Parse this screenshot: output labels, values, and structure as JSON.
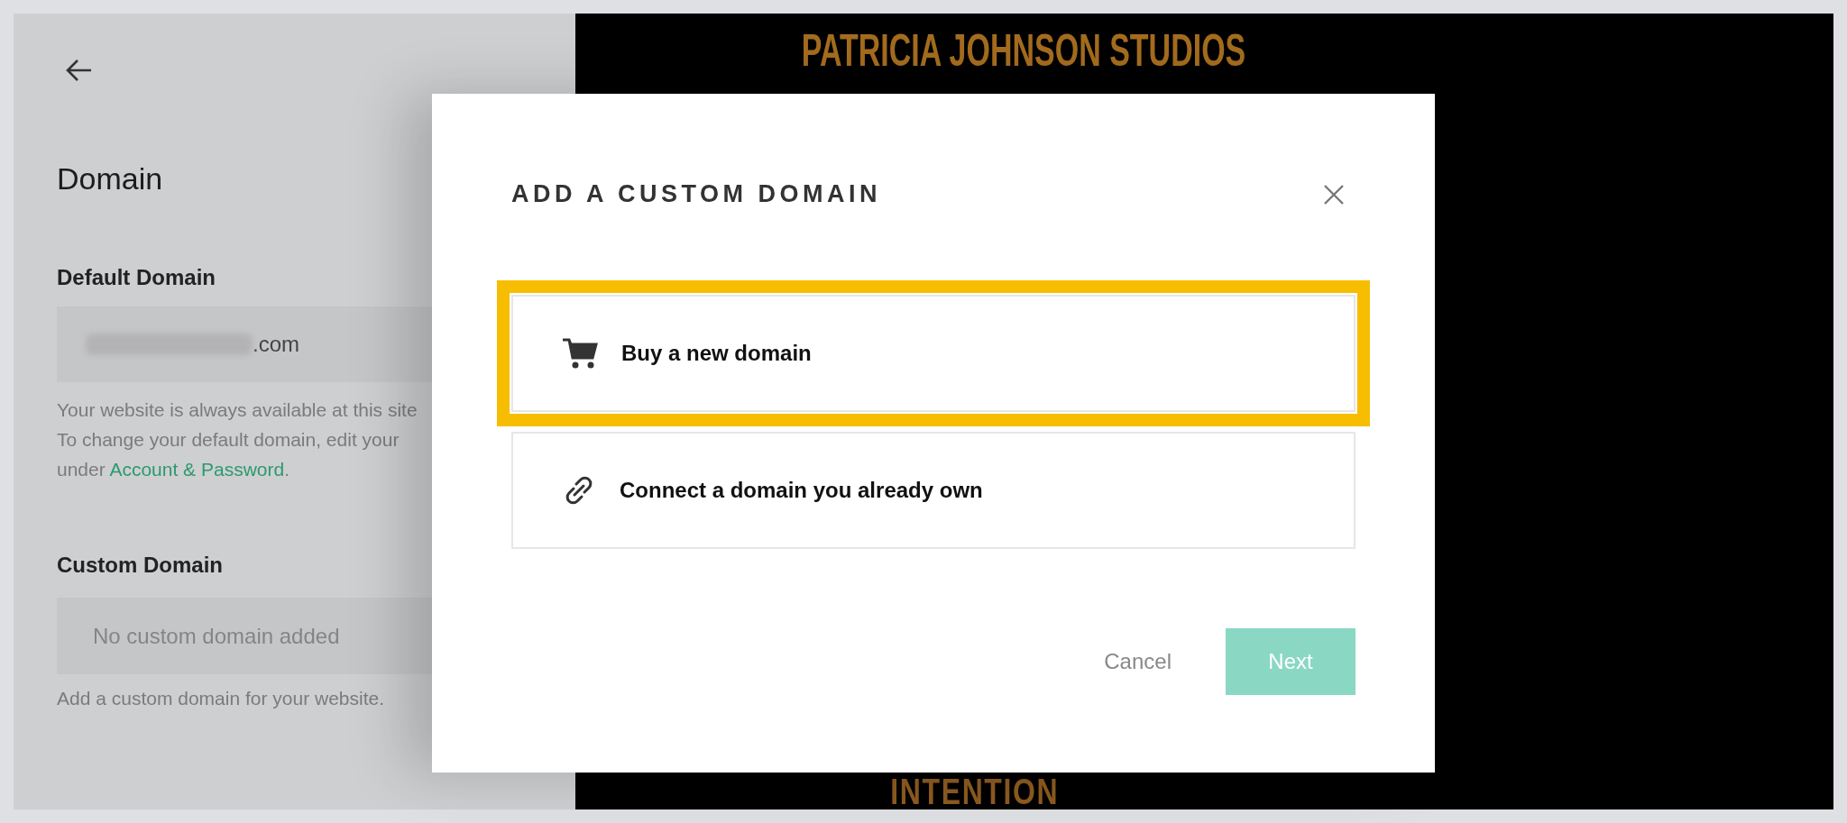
{
  "settings_panel": {
    "title": "Domain",
    "default_domain": {
      "label": "Default Domain",
      "value_suffix": ".com",
      "help_lines": [
        "Your website is always available at this site",
        "To change your default domain, edit your"
      ],
      "help_link_line": {
        "before": "under ",
        "link": "Account & Password",
        "after": "."
      }
    },
    "custom_domain": {
      "label": "Custom Domain",
      "placeholder": "No custom domain added",
      "help": "Add a custom domain for your website."
    }
  },
  "site_preview": {
    "header": "PATRICIA JOHNSON STUDIOS",
    "heading": "INTENTION"
  },
  "dialog": {
    "title": "ADD A CUSTOM DOMAIN",
    "options": [
      {
        "kind": "cart",
        "label": "Buy a new domain",
        "selected": true
      },
      {
        "kind": "link",
        "label": "Connect a domain you already own",
        "selected": false
      }
    ],
    "buttons": [
      {
        "kind": "secondary",
        "label": "Cancel"
      },
      {
        "kind": "primary",
        "label": "Next"
      }
    ]
  }
}
